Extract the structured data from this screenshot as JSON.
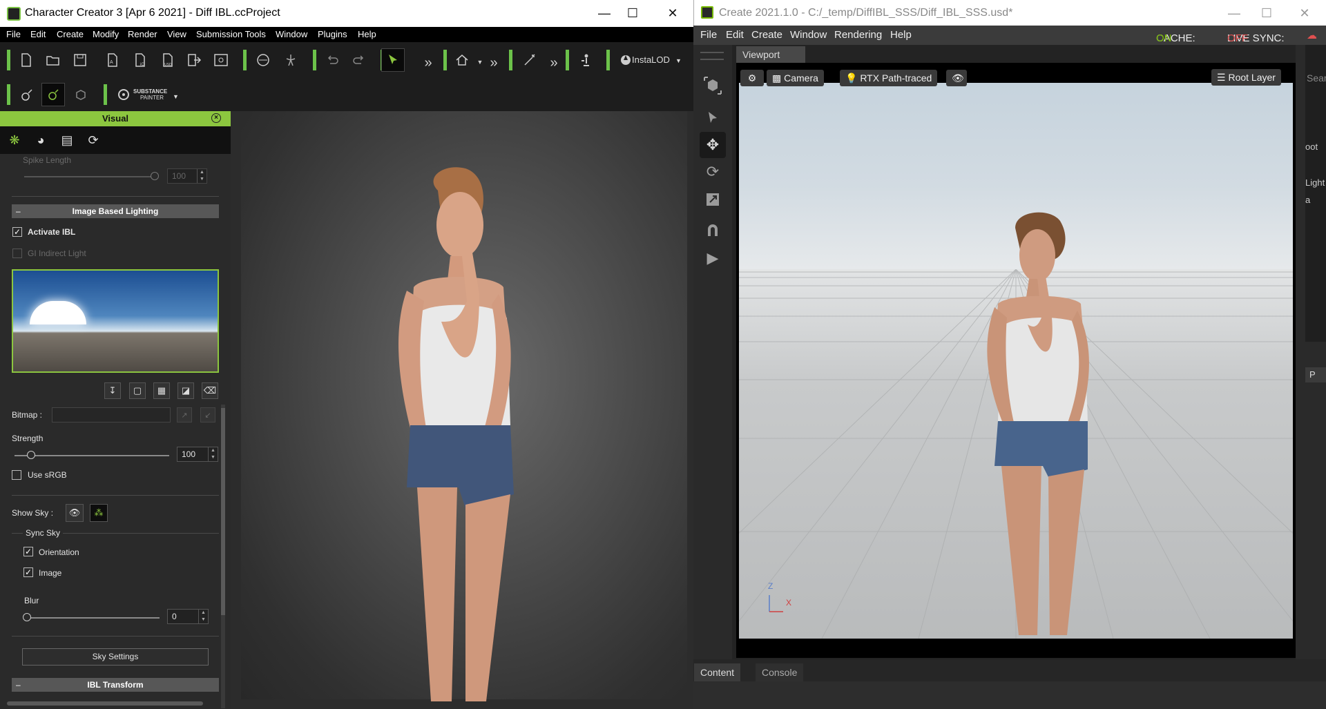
{
  "cc": {
    "title": "Character Creator 3 [Apr  6 2021] - Diff IBL.ccProject",
    "menu": [
      "File",
      "Edit",
      "Create",
      "Modify",
      "Render",
      "View",
      "Submission Tools",
      "Window",
      "Plugins",
      "Help"
    ],
    "toolbar": {
      "instalod_label": "InstaLOD",
      "substance_line1": "SUBSTANCE",
      "substance_line2": "PAINTER"
    },
    "panel": {
      "header": "Visual",
      "spike_length_label": "Spike Length",
      "spike_length_value": "100",
      "ibl_section": "Image Based Lighting",
      "activate_ibl_label": "Activate IBL",
      "gi_label": "GI Indirect Light",
      "bitmap_label": "Bitmap :",
      "strength_label": "Strength",
      "strength_value": "100",
      "use_srgb_label": "Use sRGB",
      "show_sky_label": "Show Sky :",
      "sync_sky_label": "Sync Sky",
      "orientation_label": "Orientation",
      "image_label": "Image",
      "blur_label": "Blur",
      "blur_value": "0",
      "sky_settings_label": "Sky Settings",
      "ibl_transform_section": "IBL Transform"
    }
  },
  "ov": {
    "title": "Create 2021.1.0 - C:/_temp/DiffIBL_SSS/Diff_IBL_SSS.usd*",
    "menu": [
      "File",
      "Edit",
      "Create",
      "Window",
      "Rendering",
      "Help"
    ],
    "cache_label": "CACHE:",
    "cache_value": "ON",
    "live_sync_label": "LIVE SYNC:",
    "live_sync_value": "OFF",
    "viewport_tab": "Viewport",
    "camera_label": "Camera",
    "renderer_label": "RTX Path-traced",
    "root_layer_label": "Root Layer",
    "search_fragment": "Sear",
    "right_fragments": [
      "oot",
      "Light",
      "a"
    ],
    "p_fragment": "P",
    "axis_z": "Z",
    "axis_x": "X",
    "bottom_tabs": [
      "Content",
      "Console"
    ]
  },
  "colors": {
    "cc_accent": "#8cc63f",
    "ov_accent": "#76b900",
    "live_off": "#e05050"
  }
}
